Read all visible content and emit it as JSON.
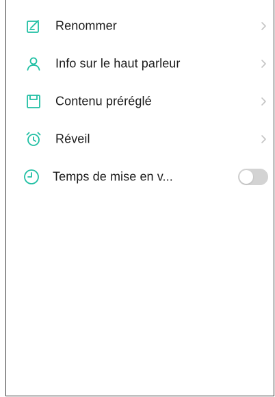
{
  "colors": {
    "accent": "#1fbfa3",
    "chevron": "#c4c4c4",
    "toggle_off": "#d3d3d3"
  },
  "menu": {
    "items": [
      {
        "label": "Renommer",
        "icon": "edit-icon"
      },
      {
        "label": "Info sur le haut parleur",
        "icon": "person-icon"
      },
      {
        "label": "Contenu préréglé",
        "icon": "preset-icon"
      },
      {
        "label": "Réveil",
        "icon": "alarm-clock-icon"
      },
      {
        "label": "Temps de mise en v...",
        "icon": "clock-icon",
        "toggle": "off"
      }
    ]
  }
}
